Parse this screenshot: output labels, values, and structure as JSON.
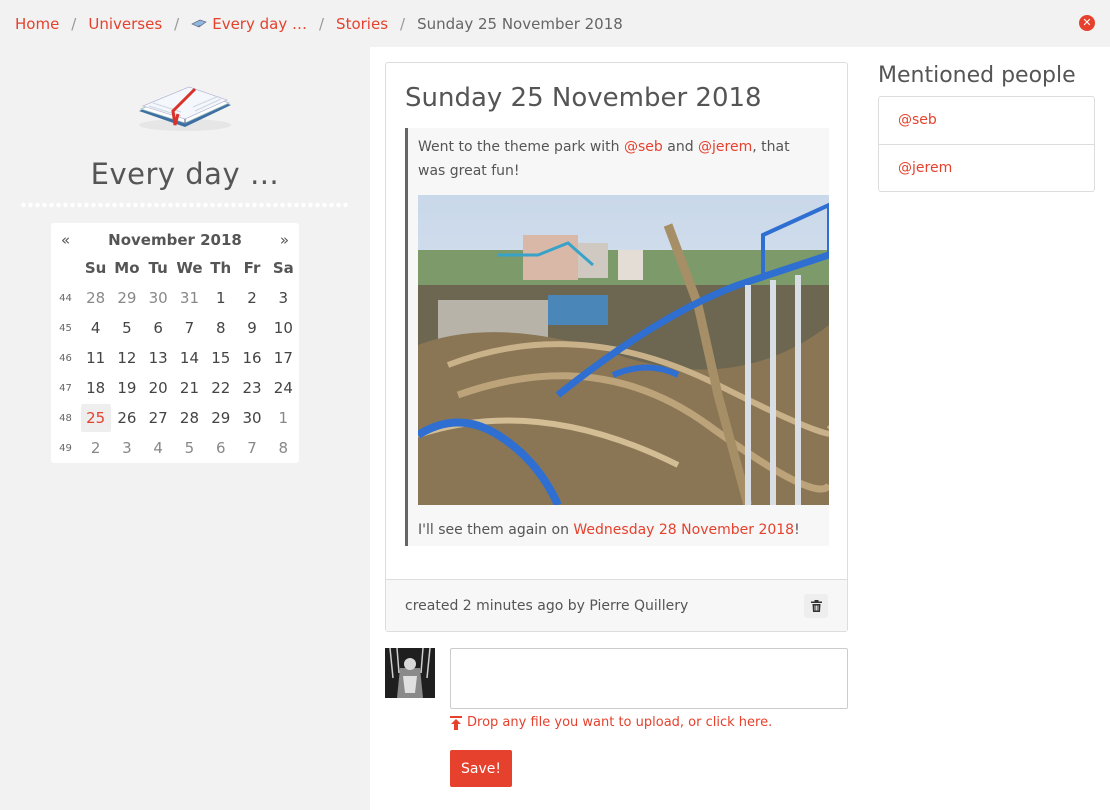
{
  "breadcrumb": {
    "items": [
      {
        "label": "Home"
      },
      {
        "label": "Universes"
      },
      {
        "label": "Every day …"
      },
      {
        "label": "Stories"
      }
    ],
    "current": "Sunday 25 November 2018",
    "separator": "/"
  },
  "sidebar": {
    "universe_title": "Every day …",
    "calendar": {
      "prev": "«",
      "next": "»",
      "month_label": "November 2018",
      "weekdays": [
        "Su",
        "Mo",
        "Tu",
        "We",
        "Th",
        "Fr",
        "Sa"
      ],
      "weeks": [
        {
          "num": "44",
          "days": [
            "28",
            "29",
            "30",
            "31",
            "1",
            "2",
            "3"
          ]
        },
        {
          "num": "45",
          "days": [
            "4",
            "5",
            "6",
            "7",
            "8",
            "9",
            "10"
          ]
        },
        {
          "num": "46",
          "days": [
            "11",
            "12",
            "13",
            "14",
            "15",
            "16",
            "17"
          ]
        },
        {
          "num": "47",
          "days": [
            "18",
            "19",
            "20",
            "21",
            "22",
            "23",
            "24"
          ]
        },
        {
          "num": "48",
          "days": [
            "25",
            "26",
            "27",
            "28",
            "29",
            "30",
            "1"
          ]
        },
        {
          "num": "49",
          "days": [
            "2",
            "3",
            "4",
            "5",
            "6",
            "7",
            "8"
          ]
        }
      ],
      "today": "25"
    }
  },
  "story": {
    "title": "Sunday 25 November 2018",
    "p1_before": "Went to the theme park with ",
    "mention1": "@seb",
    "p1_and": " and ",
    "mention2": "@jerem",
    "p1_after": ", that was great fun!",
    "p2_before": "I'll see them again on ",
    "p2_link": "Wednesday 28 November 2018",
    "p2_after": "!",
    "footer_text": "created 2 minutes ago by Pierre Quillery"
  },
  "comment": {
    "upload_text": "Drop any file you want to upload, or click here.",
    "save_label": "Save!"
  },
  "mentions": {
    "title": "Mentioned people",
    "items": [
      "@seb",
      "@jerem"
    ]
  },
  "colors": {
    "accent": "#e5412d",
    "sidebar_bg": "#f2f2f2",
    "text": "#555555"
  },
  "icons": {
    "close": "close-circle-icon",
    "trash": "trash-icon",
    "upload": "upload-arrow-icon",
    "logo": "book-icon"
  }
}
